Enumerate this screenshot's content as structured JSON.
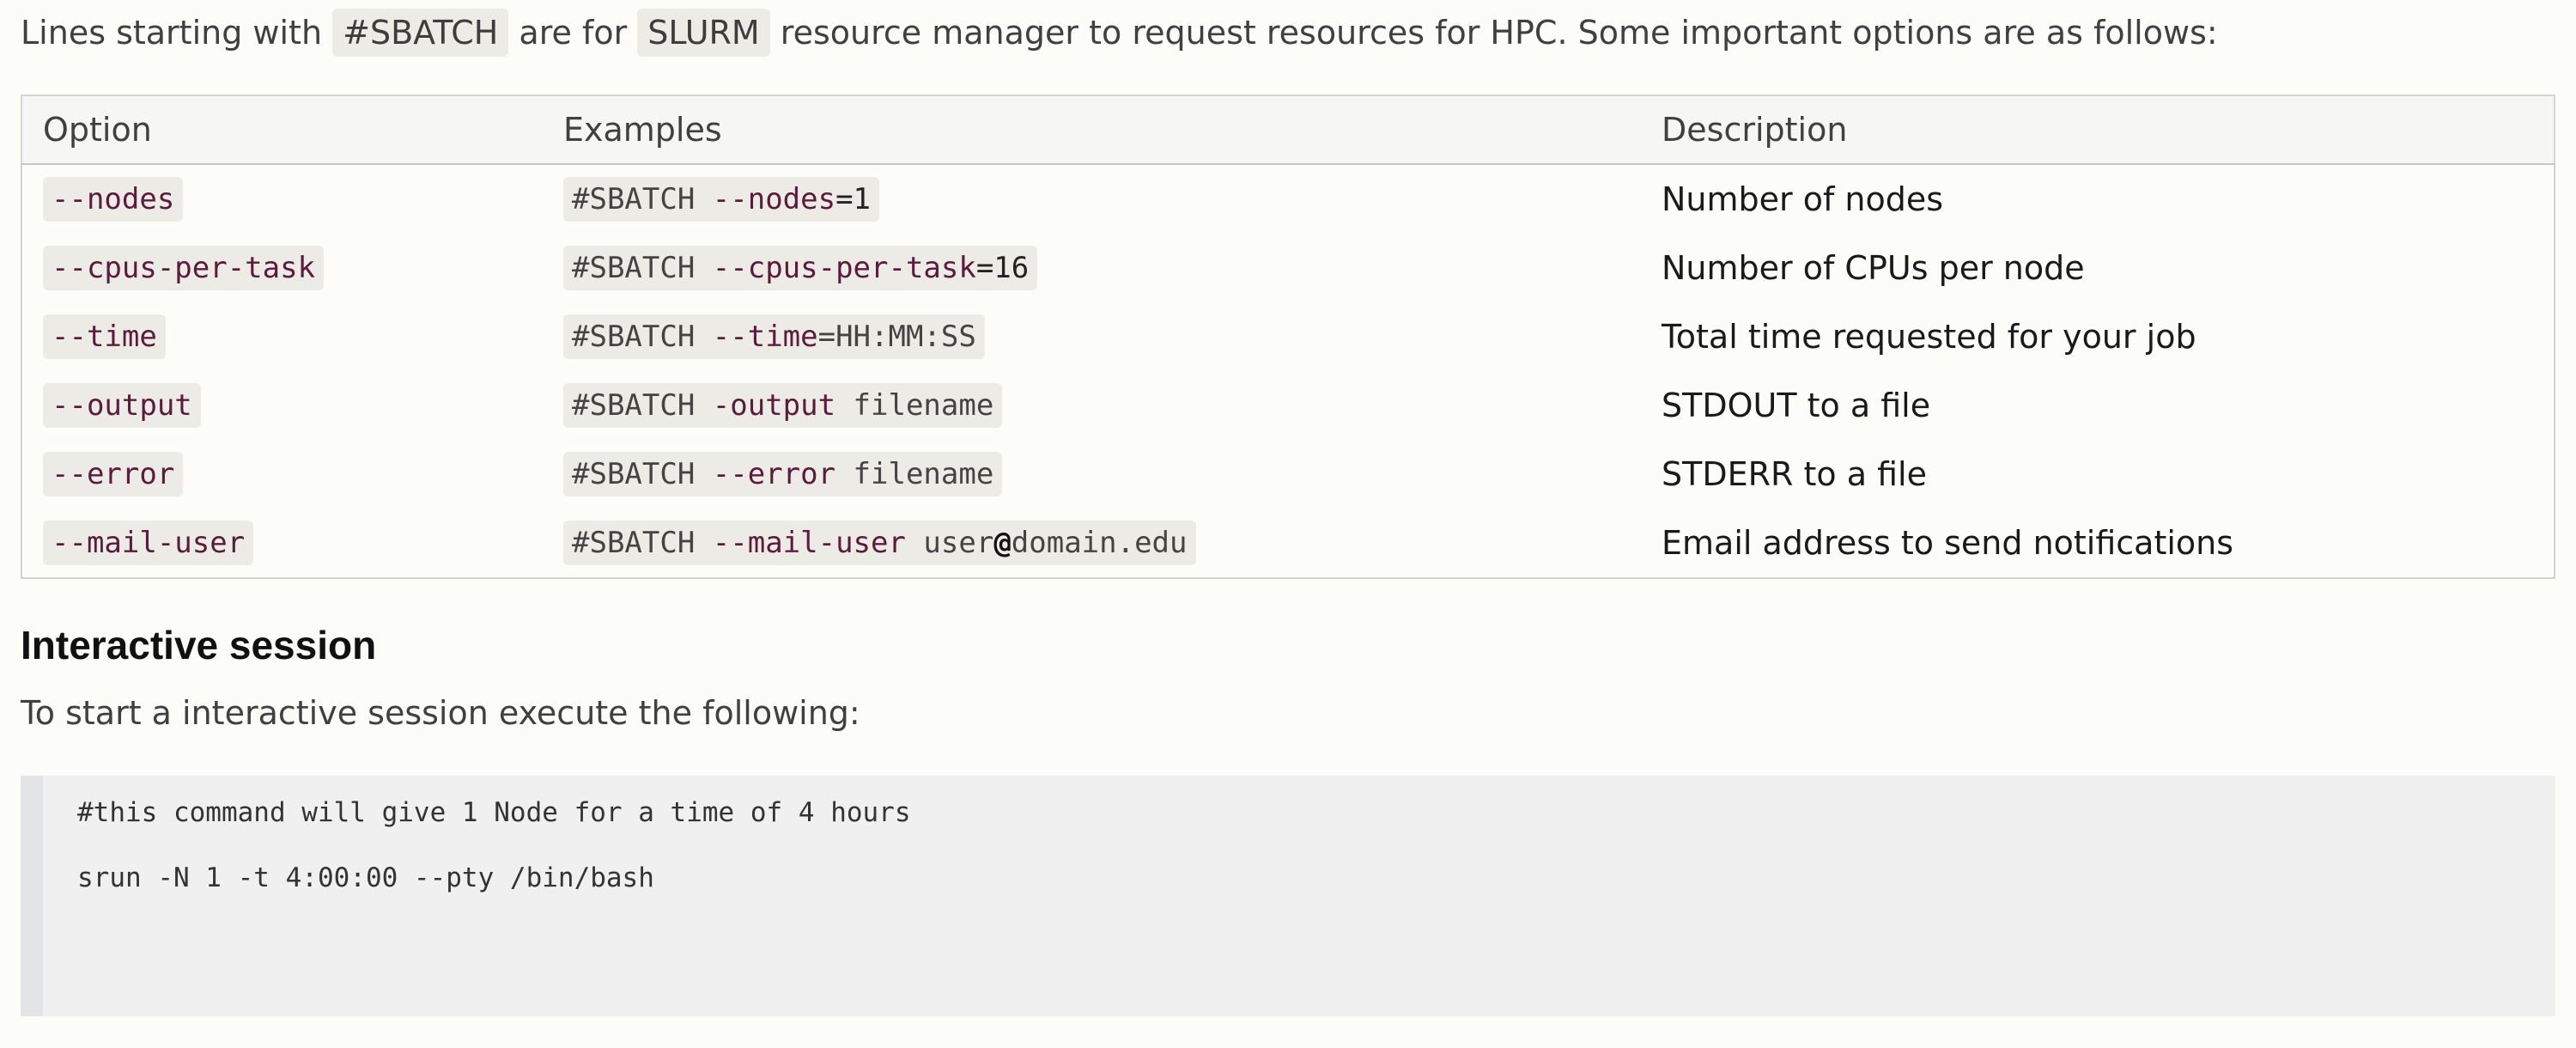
{
  "intro": {
    "prefix": "Lines starting with",
    "chip1": "#SBATCH",
    "middle": "are for",
    "chip2": "SLURM",
    "suffix": "resource manager to request resources for HPC. Some important options are as follows:"
  },
  "table": {
    "headers": [
      "Option",
      "Examples",
      "Description"
    ],
    "rows": [
      {
        "option": "--nodes",
        "ex_prefix": "#SBATCH",
        "ex_flag": "--nodes",
        "ex_rest": "=1",
        "description": "Number of nodes"
      },
      {
        "option": "--cpus-per-task",
        "ex_prefix": "#SBATCH",
        "ex_flag": "--cpus-per-task",
        "ex_rest": "=16",
        "description": "Number of CPUs per node"
      },
      {
        "option": "--time",
        "ex_prefix": "#SBATCH",
        "ex_flag": "--time",
        "ex_rest": "=HH:MM:SS",
        "description": "Total time requested for your job"
      },
      {
        "option": "--output",
        "ex_prefix": "#SBATCH",
        "ex_flag": "-output",
        "ex_rest": " filename",
        "description": "STDOUT to a file"
      },
      {
        "option": "--error",
        "ex_prefix": "#SBATCH",
        "ex_flag": "--error",
        "ex_rest": " filename",
        "description": "STDERR to a file"
      },
      {
        "option": "--mail-user",
        "ex_prefix": "#SBATCH",
        "ex_flag": "--mail-user",
        "ex_rest": " user",
        "ex_at": "@",
        "ex_rest2": "domain.edu",
        "description": "Email address to send notifications"
      }
    ]
  },
  "section": {
    "title": "Interactive session",
    "lead": "To start a interactive session execute the following:"
  },
  "code": {
    "line1": "#this command will give 1 Node for a time of 4 hours",
    "line2": "srun -N 1 -t 4:00:00 --pty /bin/bash"
  }
}
